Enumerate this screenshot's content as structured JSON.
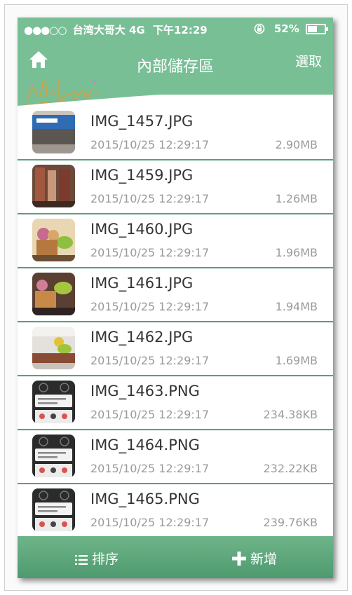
{
  "status_bar": {
    "signal_dots": "●●●○○",
    "carrier": "台湾大哥大",
    "network": "4G",
    "time": "下午12:29",
    "battery": "52%"
  },
  "header": {
    "title": "內部儲存區",
    "select_label": "選取"
  },
  "files": [
    {
      "name": "IMG_1457.JPG",
      "date": "2015/10/25 12:29:17",
      "size": "2.90MB"
    },
    {
      "name": "IMG_1459.JPG",
      "date": "2015/10/25 12:29:17",
      "size": "1.26MB"
    },
    {
      "name": "IMG_1460.JPG",
      "date": "2015/10/25 12:29:17",
      "size": "1.96MB"
    },
    {
      "name": "IMG_1461.JPG",
      "date": "2015/10/25 12:29:17",
      "size": "1.94MB"
    },
    {
      "name": "IMG_1462.JPG",
      "date": "2015/10/25 12:29:17",
      "size": "1.69MB"
    },
    {
      "name": "IMG_1463.PNG",
      "date": "2015/10/25 12:29:17",
      "size": "234.38KB"
    },
    {
      "name": "IMG_1464.PNG",
      "date": "2015/10/25 12:29:17",
      "size": "232.22KB"
    },
    {
      "name": "IMG_1465.PNG",
      "date": "2015/10/25 12:29:17",
      "size": "239.76KB"
    }
  ],
  "footer": {
    "sort_label": "排序",
    "add_label": "新增"
  },
  "colors": {
    "accent": "#79bf96",
    "footer": "#5aa67a",
    "divider": "#5a9f7c"
  },
  "icons": [
    "home-icon",
    "list-icon",
    "plus-icon"
  ]
}
